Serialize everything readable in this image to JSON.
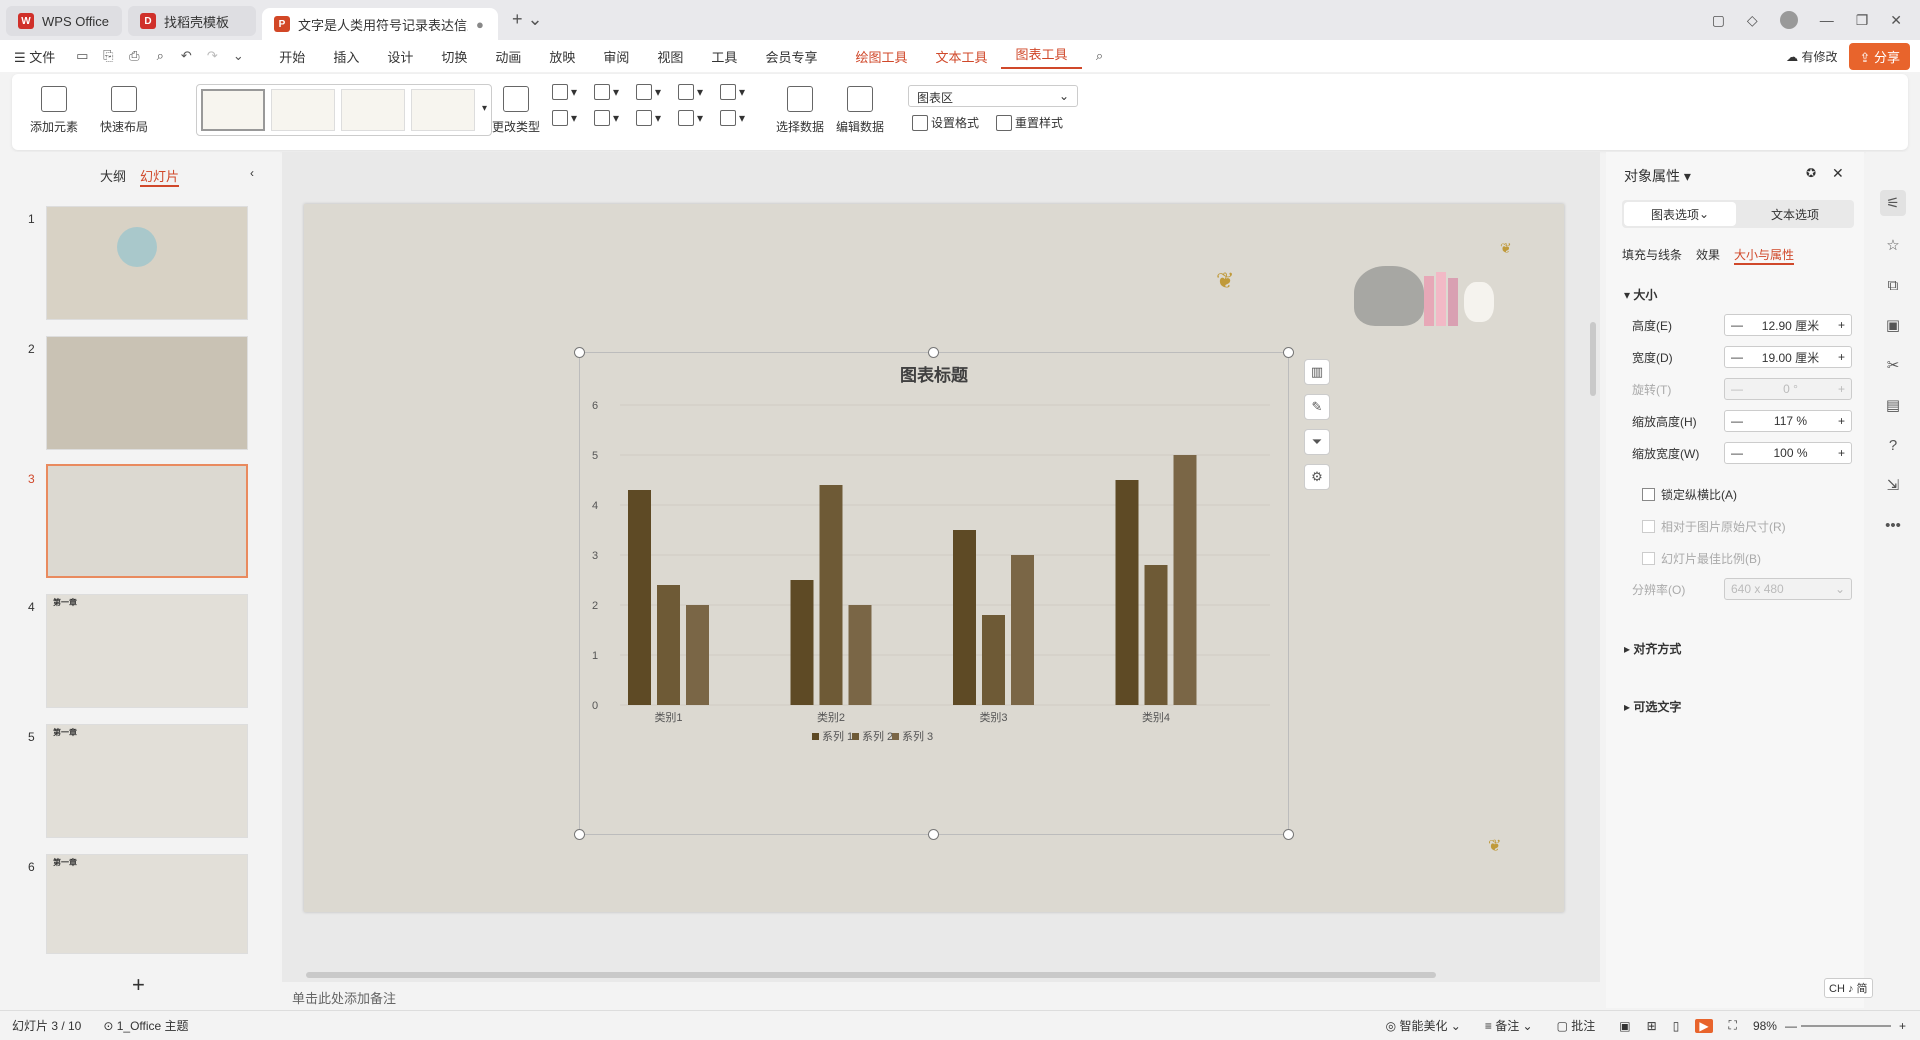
{
  "tabs": [
    {
      "label": "WPS Office"
    },
    {
      "label": "找稻壳模板"
    },
    {
      "label": "文字是人类用符号记录表达信息以..."
    }
  ],
  "menu": {
    "file": "文件",
    "items": [
      "开始",
      "插入",
      "设计",
      "切换",
      "动画",
      "放映",
      "审阅",
      "视图",
      "工具",
      "会员专享"
    ],
    "tools": [
      "绘图工具",
      "文本工具",
      "图表工具"
    ],
    "modify": "有修改",
    "share": "分享"
  },
  "ribbon": {
    "add_element": "添加元素",
    "quick_layout": "快速布局",
    "change_type": "更改类型",
    "select_data": "选择数据",
    "edit_data": "编辑数据",
    "chart_area": "图表区",
    "set_format": "设置格式",
    "reset_style": "重置样式"
  },
  "left": {
    "tab_outline": "大纲",
    "tab_slides": "幻灯片",
    "slides": [
      {
        "num": "1"
      },
      {
        "num": "2"
      },
      {
        "num": "3"
      },
      {
        "num": "4",
        "title": "第一章"
      },
      {
        "num": "5",
        "title": "第一章"
      },
      {
        "num": "6",
        "title": "第一章"
      }
    ]
  },
  "notes_placeholder": "单击此处添加备注",
  "chart_data": {
    "type": "bar",
    "title": "图表标题",
    "categories": [
      "类别1",
      "类别2",
      "类别3",
      "类别4"
    ],
    "series": [
      {
        "name": "系列 1",
        "values": [
          4.3,
          2.5,
          3.5,
          4.5
        ]
      },
      {
        "name": "系列 2",
        "values": [
          2.4,
          4.4,
          1.8,
          2.8
        ]
      },
      {
        "name": "系列 3",
        "values": [
          2,
          2,
          3,
          5
        ]
      }
    ],
    "ylim": [
      0,
      6
    ],
    "yticks": [
      "0",
      "1",
      "2",
      "3",
      "4",
      "5",
      "6"
    ],
    "legend": "bottom",
    "grid": true,
    "colors": [
      "#5e4a25",
      "#6e5a36",
      "#7a6646"
    ]
  },
  "panel": {
    "title": "对象属性",
    "tab_chart": "图表选项",
    "tab_text": "文本选项",
    "sub": [
      "填充与线条",
      "效果",
      "大小与属性"
    ],
    "size": "大小",
    "height_label": "高度(E)",
    "height_value": "12.90",
    "height_unit": "厘米",
    "width_label": "宽度(D)",
    "width_value": "19.00",
    "width_unit": "厘米",
    "rotate_label": "旋转(T)",
    "rotate_value": "0",
    "rotate_unit": "°",
    "scale_h_label": "缩放高度(H)",
    "scale_h_value": "117",
    "scale_h_unit": "%",
    "scale_w_label": "缩放宽度(W)",
    "scale_w_value": "100",
    "scale_w_unit": "%",
    "lock": "锁定纵横比(A)",
    "relative": "相对于图片原始尺寸(R)",
    "best": "幻灯片最佳比例(B)",
    "res_label": "分辨率(O)",
    "res_value": "640 x 480",
    "align": "对齐方式",
    "alt": "可选文字"
  },
  "status": {
    "slide": "幻灯片 3 / 10",
    "theme": "1_Office 主题",
    "beautify": "智能美化",
    "notes": "备注",
    "comment": "批注",
    "zoom": "98%",
    "ime": "CH ♪ 简"
  }
}
